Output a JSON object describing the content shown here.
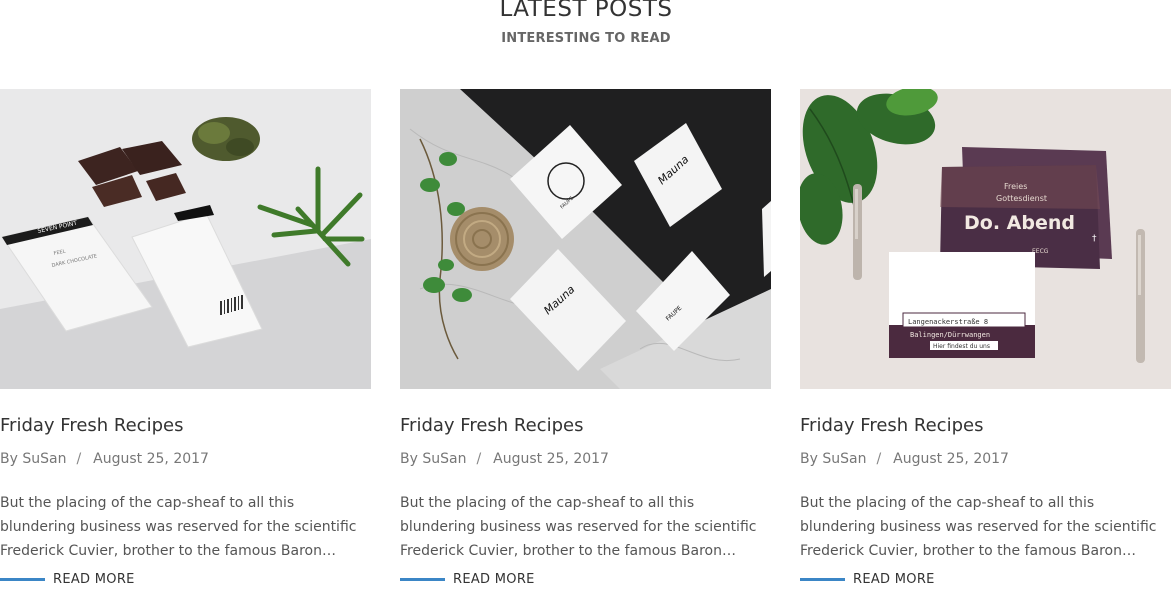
{
  "section": {
    "title": "LATEST POSTS",
    "subtitle": "INTERESTING TO READ"
  },
  "accent_color": "#3b86c6",
  "posts": [
    {
      "title": "Friday Fresh Recipes",
      "author": "By SuSan",
      "separator": "/",
      "date": "August 25, 2017",
      "excerpt": "But the placing of the cap-sheaf to all this blundering business was reserved for the scientific Frederick Cuvier, brother to the famous Baron…",
      "read_more": "READ MORE",
      "image_label": "SEVEN POINT"
    },
    {
      "title": "Friday Fresh Recipes",
      "author": "By SuSan",
      "separator": "/",
      "date": "August 25, 2017",
      "excerpt": "But the placing of the cap-sheaf to all this blundering business was reserved for the scientific Frederick Cuvier, brother to the famous Baron…",
      "read_more": "READ MORE",
      "image_label": "FAUPE"
    },
    {
      "title": "Friday Fresh Recipes",
      "author": "By SuSan",
      "separator": "/",
      "date": "August 25, 2017",
      "excerpt": "But the placing of the cap-sheaf to all this blundering business was reserved for the scientific Frederick Cuvier, brother to the famous Baron…",
      "read_more": "READ MORE",
      "image_label": "Do. Abend"
    }
  ]
}
